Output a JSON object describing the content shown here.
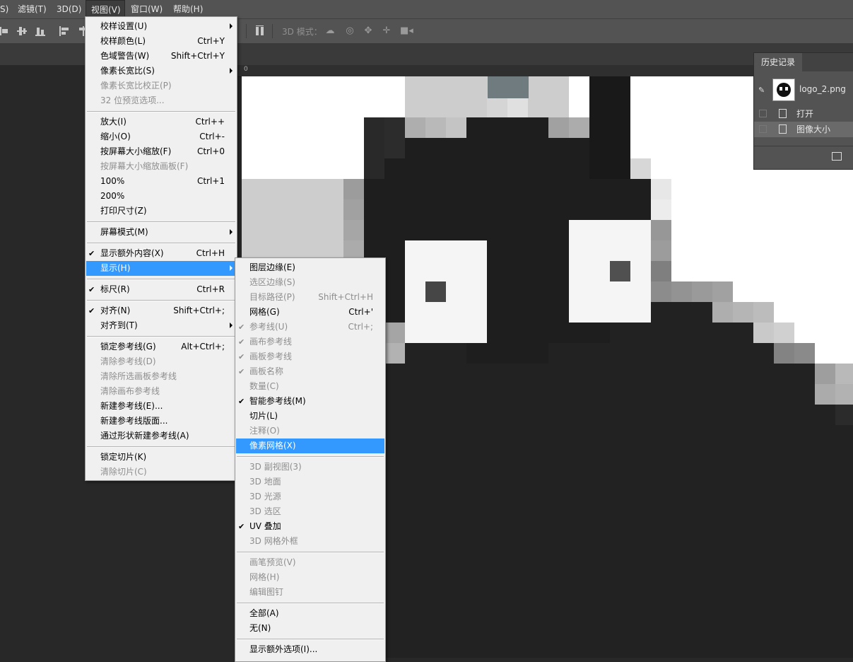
{
  "menubar": {
    "items": [
      {
        "label": "S)"
      },
      {
        "label": "滤镜(T)"
      },
      {
        "label": "3D(D)"
      },
      {
        "label": "视图(V)",
        "active": true
      },
      {
        "label": "窗口(W)"
      },
      {
        "label": "帮助(H)"
      }
    ]
  },
  "options_bar": {
    "label_3d": "3D 模式："
  },
  "ruler": {
    "zero": "0"
  },
  "history_panel": {
    "tab": "历史记录",
    "snapshot_name": "logo_2.png",
    "steps": [
      {
        "label": "打开",
        "selected": false
      },
      {
        "label": "图像大小",
        "selected": true
      }
    ]
  },
  "view_menu": {
    "items": [
      {
        "label": "校样设置(U)",
        "submenu": true
      },
      {
        "label": "校样颜色(L)",
        "shortcut": "Ctrl+Y"
      },
      {
        "label": "色域警告(W)",
        "shortcut": "Shift+Ctrl+Y"
      },
      {
        "label": "像素长宽比(S)",
        "submenu": true
      },
      {
        "label": "像素长宽比校正(P)",
        "disabled": true
      },
      {
        "label": "32 位预览选项...",
        "disabled": true
      },
      {
        "sep": true
      },
      {
        "label": "放大(I)",
        "shortcut": "Ctrl++"
      },
      {
        "label": "缩小(O)",
        "shortcut": "Ctrl+-"
      },
      {
        "label": "按屏幕大小缩放(F)",
        "shortcut": "Ctrl+0"
      },
      {
        "label": "按屏幕大小缩放画板(F)",
        "disabled": true
      },
      {
        "label": "100%",
        "shortcut": "Ctrl+1"
      },
      {
        "label": "200%"
      },
      {
        "label": "打印尺寸(Z)"
      },
      {
        "sep": true
      },
      {
        "label": "屏幕模式(M)",
        "submenu": true
      },
      {
        "sep": true
      },
      {
        "label": "显示额外内容(X)",
        "shortcut": "Ctrl+H",
        "checked": true
      },
      {
        "label": "显示(H)",
        "submenu": true,
        "highlighted": true
      },
      {
        "sep": true
      },
      {
        "label": "标尺(R)",
        "shortcut": "Ctrl+R",
        "checked": true
      },
      {
        "sep": true
      },
      {
        "label": "对齐(N)",
        "shortcut": "Shift+Ctrl+;",
        "checked": true
      },
      {
        "label": "对齐到(T)",
        "submenu": true
      },
      {
        "sep": true
      },
      {
        "label": "锁定参考线(G)",
        "shortcut": "Alt+Ctrl+;"
      },
      {
        "label": "清除参考线(D)",
        "disabled": true
      },
      {
        "label": "清除所选画板参考线",
        "disabled": true
      },
      {
        "label": "清除画布参考线",
        "disabled": true
      },
      {
        "label": "新建参考线(E)..."
      },
      {
        "label": "新建参考线版面..."
      },
      {
        "label": "通过形状新建参考线(A)"
      },
      {
        "sep": true
      },
      {
        "label": "锁定切片(K)"
      },
      {
        "label": "清除切片(C)",
        "disabled": true
      }
    ]
  },
  "show_submenu": {
    "items": [
      {
        "label": "图层边缘(E)"
      },
      {
        "label": "选区边缘(S)",
        "disabled": true
      },
      {
        "label": "目标路径(P)",
        "shortcut": "Shift+Ctrl+H",
        "disabled": true
      },
      {
        "label": "网格(G)",
        "shortcut": "Ctrl+'"
      },
      {
        "label": "参考线(U)",
        "shortcut": "Ctrl+;",
        "disabled": true,
        "checked": true
      },
      {
        "label": "画布参考线",
        "disabled": true,
        "checked": true
      },
      {
        "label": "画板参考线",
        "disabled": true,
        "checked": true
      },
      {
        "label": "画板名称",
        "disabled": true,
        "checked": true
      },
      {
        "label": "数量(C)",
        "disabled": true
      },
      {
        "label": "智能参考线(M)",
        "checked": true
      },
      {
        "label": "切片(L)"
      },
      {
        "label": "注释(O)",
        "disabled": true
      },
      {
        "label": "像素网格(X)",
        "highlighted": true
      },
      {
        "sep": true
      },
      {
        "label": "3D 副视图(3)",
        "disabled": true
      },
      {
        "label": "3D 地面",
        "disabled": true
      },
      {
        "label": "3D 光源",
        "disabled": true
      },
      {
        "label": "3D 选区",
        "disabled": true
      },
      {
        "label": "UV 叠加",
        "checked": true
      },
      {
        "label": "3D 网格外框",
        "disabled": true
      },
      {
        "sep": true
      },
      {
        "label": "画笔预览(V)",
        "disabled": true
      },
      {
        "label": "网格(H)",
        "disabled": true
      },
      {
        "label": "编辑图钉",
        "disabled": true
      },
      {
        "sep": true
      },
      {
        "label": "全部(A)"
      },
      {
        "label": "无(N)"
      },
      {
        "sep": true
      },
      {
        "label": "显示额外选项(I)..."
      }
    ]
  }
}
